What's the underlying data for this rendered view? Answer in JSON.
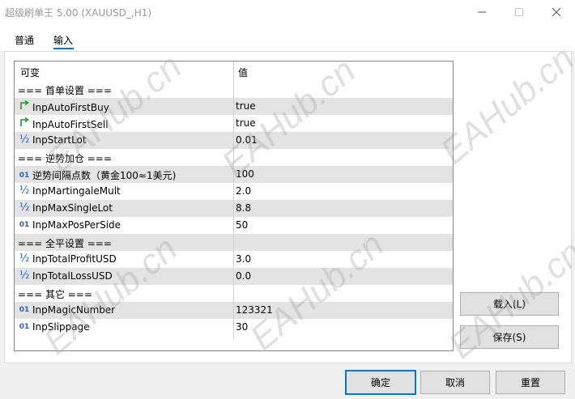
{
  "window": {
    "title": "超级刷单王 5.00 (XAUUSD_,H1)"
  },
  "tabs": [
    {
      "label": "普通"
    },
    {
      "label": "输入"
    }
  ],
  "table": {
    "headers": {
      "name": "可变",
      "value": "值"
    },
    "rows": [
      {
        "type": "section",
        "name": "=== 首单设置 ===",
        "value": ""
      },
      {
        "type": "bool",
        "icon": "green-arrow-bool-icon",
        "name": "InpAutoFirstBuy",
        "value": "true"
      },
      {
        "type": "bool",
        "icon": "green-arrow-bool-icon",
        "name": "InpAutoFirstSell",
        "value": "true"
      },
      {
        "type": "double",
        "icon": "half-double-icon",
        "name": "InpStartLot",
        "value": "0.01"
      },
      {
        "type": "section",
        "name": "=== 逆势加仓 ===",
        "value": ""
      },
      {
        "type": "int",
        "icon": "zero-one-int-icon",
        "name": "逆势间隔点数（黄金100≈1美元)",
        "value": "100"
      },
      {
        "type": "double",
        "icon": "half-double-icon",
        "name": "InpMartingaleMult",
        "value": "2.0"
      },
      {
        "type": "double",
        "icon": "half-double-icon",
        "name": "InpMaxSingleLot",
        "value": "8.8"
      },
      {
        "type": "int",
        "icon": "zero-one-int-icon",
        "name": "InpMaxPosPerSide",
        "value": "50"
      },
      {
        "type": "section",
        "name": "=== 全平设置 ===",
        "value": ""
      },
      {
        "type": "double",
        "icon": "half-double-icon",
        "name": "InpTotalProfitUSD",
        "value": "3.0"
      },
      {
        "type": "double",
        "icon": "half-double-icon",
        "name": "InpTotalLossUSD",
        "value": "0.0"
      },
      {
        "type": "section",
        "name": "=== 其它 ===",
        "value": ""
      },
      {
        "type": "int",
        "icon": "zero-one-int-icon",
        "name": "InpMagicNumber",
        "value": "123321"
      },
      {
        "type": "int",
        "icon": "zero-one-int-icon",
        "name": "InpSlippage",
        "value": "30"
      }
    ]
  },
  "buttons": {
    "load": "载入(L)",
    "save": "保存(S)",
    "ok": "确定",
    "cancel": "取消",
    "reset": "重置"
  },
  "icons": {
    "int": "01",
    "double": "½",
    "bool": "↱"
  },
  "watermark": "EAHub.cn",
  "colors": {
    "accent": "#0078d7",
    "bool_icon": "#1a9a2a",
    "num_icon": "#2a63c6"
  }
}
